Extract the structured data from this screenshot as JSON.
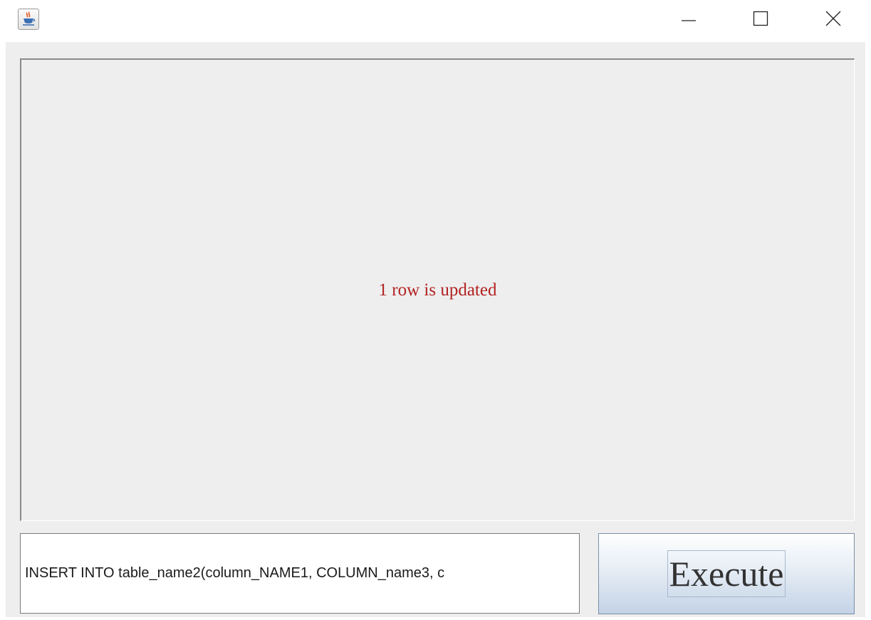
{
  "titlebar": {
    "app_icon": "java-coffee-cup-icon",
    "controls": [
      "minimize-icon",
      "maximize-icon",
      "close-icon"
    ]
  },
  "output": {
    "status_text": "1 row is updated",
    "status_color": "#b22222"
  },
  "query": {
    "value": "INSERT INTO table_name2(column_NAME1, COLUMN_name3, c"
  },
  "execute": {
    "label": "Execute"
  },
  "colors": {
    "pane_background": "#eeeeee",
    "window_background": "#ffffff"
  }
}
